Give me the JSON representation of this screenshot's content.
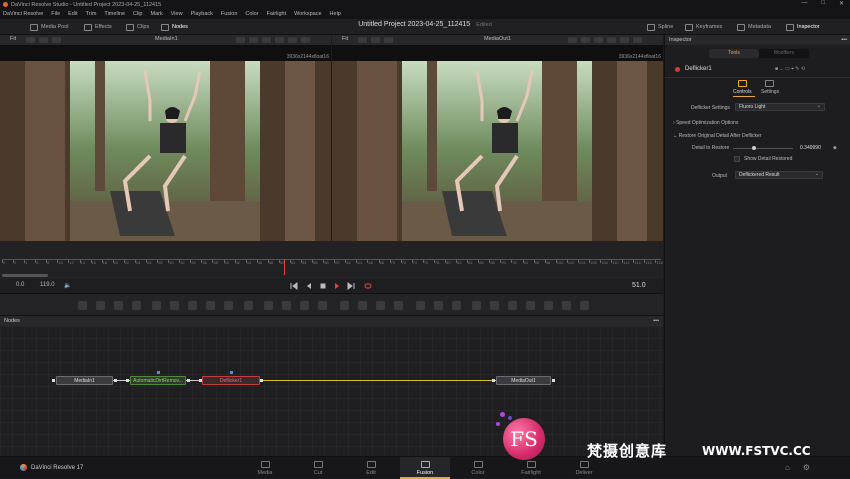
{
  "window": {
    "title": "DaVinci Resolve Studio - Untitled Project 2023-04-25_112415",
    "project_title": "Untitled Project 2023-04-25_112415",
    "status": "Edited",
    "controls": [
      "—",
      "□",
      "✕"
    ]
  },
  "menu": [
    "DaVinci Resolve",
    "File",
    "Edit",
    "Trim",
    "Timeline",
    "Clip",
    "Mark",
    "View",
    "Playback",
    "Fusion",
    "Color",
    "Fairlight",
    "Workspace",
    "Help"
  ],
  "toolbar": {
    "left": [
      {
        "label": "Media Pool",
        "icon": "media-pool-icon"
      },
      {
        "label": "Effects",
        "icon": "effects-icon"
      },
      {
        "label": "Clips",
        "icon": "clips-icon"
      },
      {
        "label": "Nodes",
        "icon": "nodes-icon"
      }
    ],
    "right": [
      {
        "label": "Spline",
        "icon": "spline-icon"
      },
      {
        "label": "Keyframes",
        "icon": "keyframes-icon"
      },
      {
        "label": "Metadata",
        "icon": "metadata-icon"
      },
      {
        "label": "Inspector",
        "icon": "inspector-icon"
      }
    ]
  },
  "viewers": [
    {
      "fit": "Fit",
      "name": "MediaIn1",
      "resolution": "3936x2144xfloat16"
    },
    {
      "fit": "Fit",
      "name": "MediaOut1",
      "resolution": "3936x2144xfloat16"
    }
  ],
  "timeline": {
    "ruler_labels": [
      "0",
      "2",
      "4",
      "6",
      "8",
      "10",
      "12",
      "14",
      "16",
      "18",
      "20",
      "22",
      "24",
      "26",
      "28",
      "30",
      "32",
      "34",
      "36",
      "38",
      "40",
      "42",
      "44",
      "46",
      "48",
      "50",
      "52",
      "54",
      "56",
      "58",
      "60",
      "62",
      "64",
      "66",
      "68",
      "70",
      "72",
      "74",
      "76",
      "78",
      "80",
      "82",
      "84",
      "86",
      "88",
      "90",
      "92",
      "94",
      "96",
      "98",
      "100",
      "102",
      "104",
      "106",
      "108",
      "110",
      "112",
      "114",
      "116",
      "118"
    ],
    "playhead_frame": 51,
    "start": "0.0",
    "end": "119.0",
    "current": "51.0"
  },
  "nodes_panel": {
    "title": "Nodes",
    "nodes": [
      "MediaIn1",
      "AutomaticDirtRemov...",
      "Deflicker1",
      "MediaOut1"
    ]
  },
  "inspector": {
    "title": "Inspector",
    "tabs": [
      "Tools",
      "Modifiers"
    ],
    "active_tab": "Tools",
    "tool_name": "Deflicker1",
    "subtabs": [
      "Controls",
      "Settings"
    ],
    "deflicker_settings_label": "Deflicker Settings",
    "deflicker_settings_value": "Fluoro Light",
    "speed_section": "Speed Optimization Options",
    "restore_section": "Restore Original Detail After Deflicker",
    "detail_label": "Detail to Restore",
    "detail_value": "0.349990",
    "detail_level": 0.35,
    "show_detail_label": "Show Detail Restored",
    "output_label": "Output",
    "output_value": "Deflickered Result"
  },
  "pages": [
    "Media",
    "Cut",
    "Edit",
    "Fusion",
    "Color",
    "Fairlight",
    "Deliver"
  ],
  "active_page": "Fusion",
  "brand": "DaVinci Resolve 17",
  "watermark": {
    "text": "梵摄创意库",
    "url": "WWW.FSTVC.CC",
    "logo": "FS"
  },
  "colors": {
    "accent": "#e6a640",
    "node_red": "#c04040",
    "node_green": "#4f8a3c"
  }
}
